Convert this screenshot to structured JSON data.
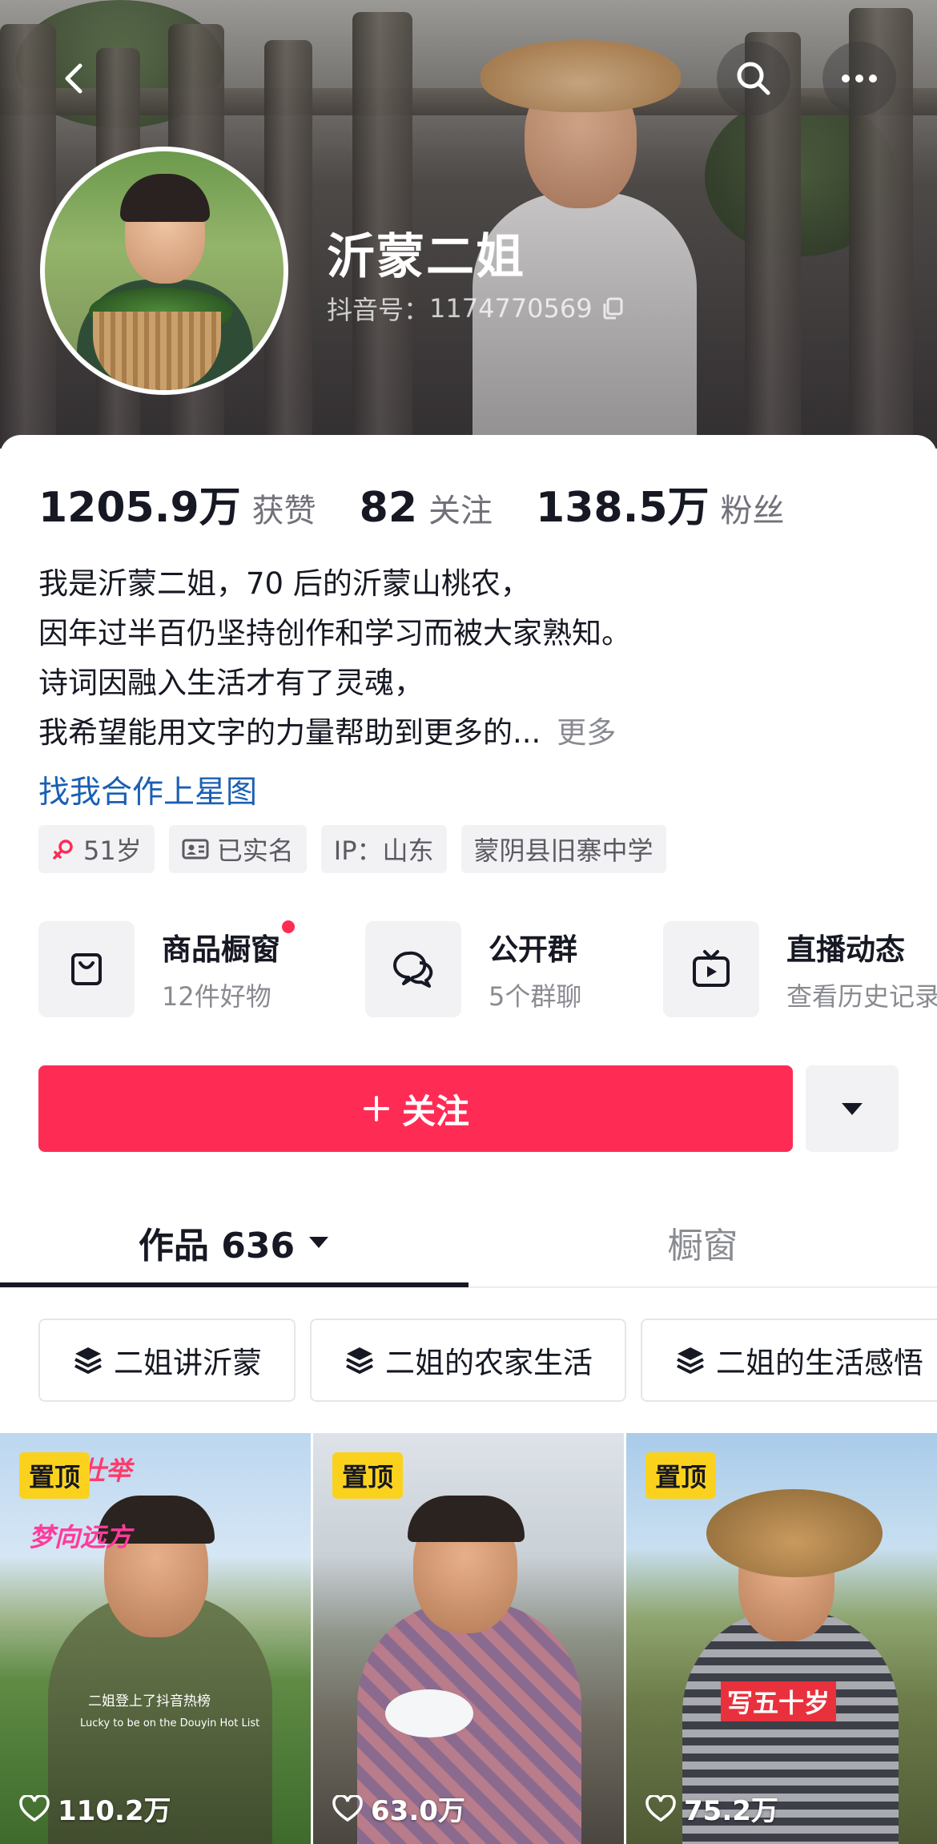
{
  "header": {
    "name": "沂蒙二姐",
    "douyin_id_label": "抖音号：",
    "douyin_id": "1174770569"
  },
  "stats": [
    {
      "num": "1205.9万",
      "label": "获赞"
    },
    {
      "num": "82",
      "label": "关注"
    },
    {
      "num": "138.5万",
      "label": "粉丝"
    }
  ],
  "bio": {
    "lines": [
      "我是沂蒙二姐，70 后的沂蒙山桃农，",
      "因年过半百仍坚持创作和学习而被大家熟知。",
      "诗词因融入生活才有了灵魂，",
      "我希望能用文字的力量帮助到更多的..."
    ],
    "more": "更多",
    "link": "找我合作上星图"
  },
  "tags": [
    "51岁",
    "已实名",
    "IP：山东",
    "蒙阴县旧寨中学"
  ],
  "features": [
    {
      "title": "商品橱窗",
      "sub": "12件好物",
      "icon": "shopping-bag-icon"
    },
    {
      "title": "公开群",
      "sub": "5个群聊",
      "icon": "chat-bubbles-icon"
    },
    {
      "title": "直播动态",
      "sub": "查看历史记录",
      "icon": "live-tv-icon"
    }
  ],
  "follow": {
    "label": "关注",
    "icon": "plus-icon"
  },
  "tabs": [
    {
      "label": "作品 636",
      "active": true
    },
    {
      "label": "橱窗",
      "active": false
    }
  ],
  "collections": [
    "二姐讲沂蒙",
    "二姐的农家生活",
    "二姐的生活感悟"
  ],
  "videos": [
    {
      "pin": "置顶",
      "likes": "110.2万",
      "overlay1": "壮举",
      "overlay2": "梦向远方",
      "caption": "二姐登上了抖音热榜",
      "caption_en": "Lucky to be on the Douyin Hot List"
    },
    {
      "pin": "置顶",
      "likes": "63.0万"
    },
    {
      "pin": "置顶",
      "likes": "75.2万",
      "overlay1": "写五十岁"
    }
  ],
  "colors": {
    "accent": "#fe2c55",
    "pin": "#fad21e",
    "link": "#1a5fb4"
  }
}
